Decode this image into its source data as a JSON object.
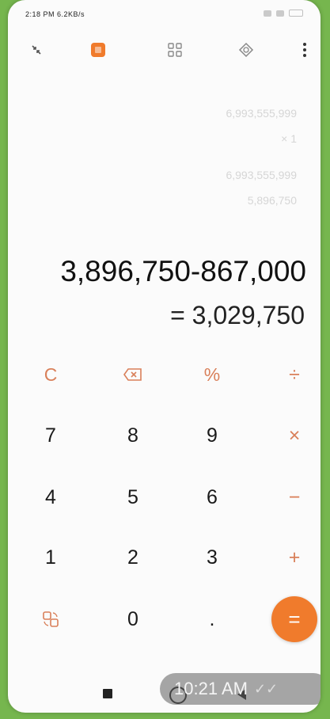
{
  "status_bar": {
    "time": "2:18 PM 6.2KB/s"
  },
  "history": [
    "6,993,555,999",
    "× 1",
    "6,993,555,999",
    "5,896,750"
  ],
  "display": {
    "expression": "3,896,750-867,000",
    "result": "= 3,029,750"
  },
  "keypad": {
    "row1": [
      "C",
      "⌫",
      "%",
      "÷"
    ],
    "row2": [
      "7",
      "8",
      "9",
      "×"
    ],
    "row3": [
      "4",
      "5",
      "6",
      "−"
    ],
    "row4": [
      "1",
      "2",
      "3",
      "+"
    ],
    "row5": [
      "⇄",
      "0",
      ".",
      "="
    ]
  },
  "nav": {
    "time": "10:21 AM",
    "ticks": "✓✓"
  },
  "colors": {
    "accent": "#f07b2c",
    "operator": "#d9805a",
    "background": "#76b64e"
  }
}
